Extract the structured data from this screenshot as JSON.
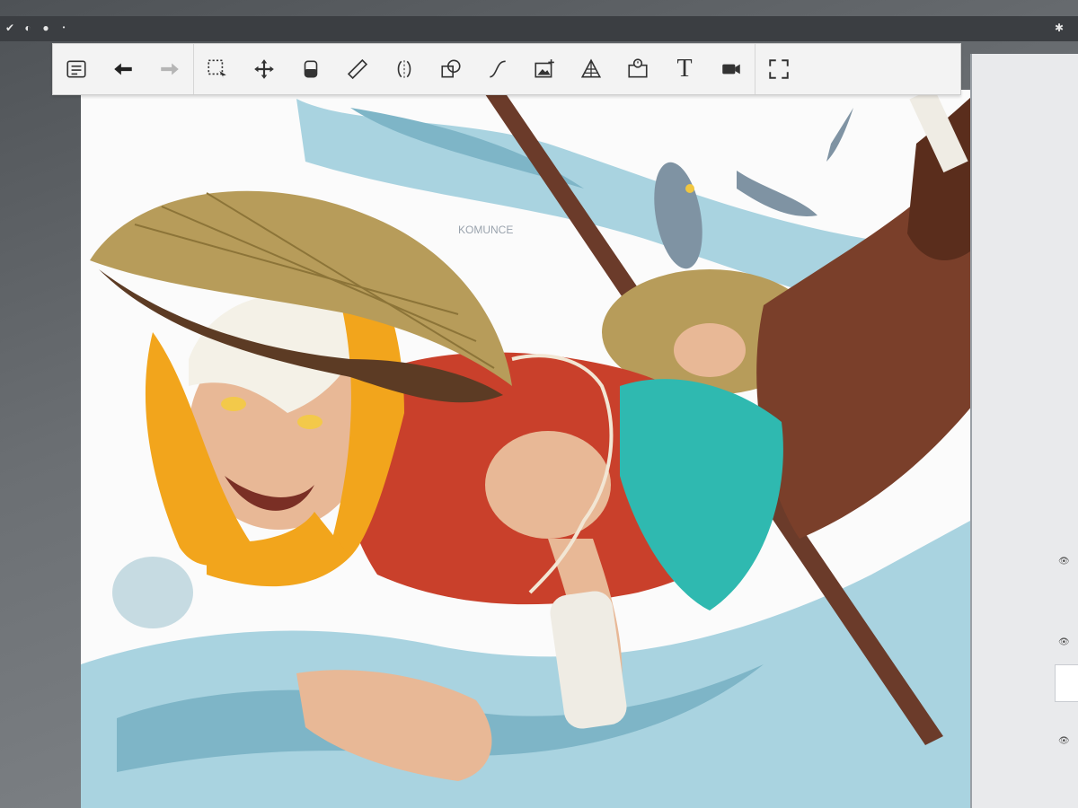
{
  "toolbar": {
    "tools": [
      {
        "name": "gallery-icon"
      },
      {
        "name": "undo-icon"
      },
      {
        "name": "redo-icon"
      },
      {
        "name": "selection-icon"
      },
      {
        "name": "transform-icon"
      },
      {
        "name": "fill-icon"
      },
      {
        "name": "ruler-icon"
      },
      {
        "name": "symmetry-icon"
      },
      {
        "name": "shape-icon"
      },
      {
        "name": "curve-icon"
      },
      {
        "name": "import-image-icon"
      },
      {
        "name": "perspective-icon"
      },
      {
        "name": "timelapse-icon"
      },
      {
        "name": "text-tool-icon",
        "label": "T"
      },
      {
        "name": "record-icon"
      },
      {
        "name": "fullscreen-icon"
      }
    ]
  },
  "artwork": {
    "signature": "KOMUNCE"
  },
  "colors": {
    "water": "#9ec9d8",
    "hat": "#b79c5a",
    "scarf": "#f2a51c",
    "tunic": "#c9402b",
    "sash": "#2fb9b0",
    "pole": "#6b3b2a",
    "skin": "#e8b896",
    "hair": "#f4f1e7",
    "boots": "#6a3825"
  }
}
